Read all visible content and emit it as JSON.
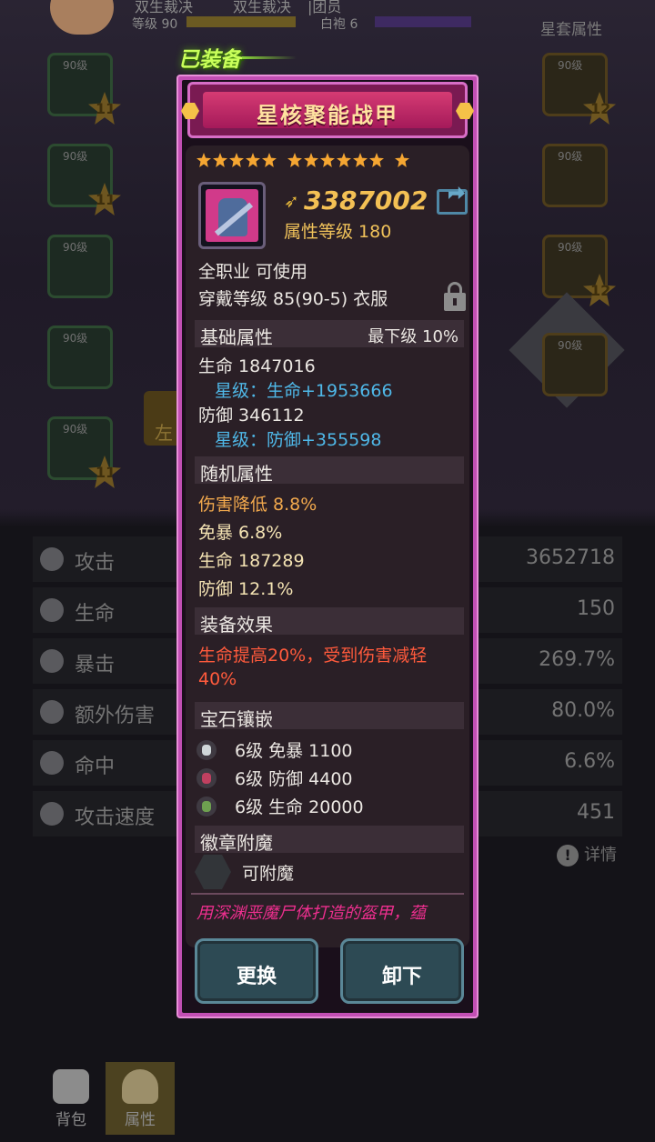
{
  "header": {
    "name_left": "双生裁决",
    "name_right": "双生裁决",
    "guild": "|团员",
    "level_label": "等级 90",
    "rank_label": "白袍 6",
    "set_attr_label": "星套属性"
  },
  "slots": {
    "level_text": "90级",
    "badges": [
      "11",
      "11",
      "11",
      "12",
      "12"
    ]
  },
  "side_button_label": "左",
  "stats": [
    {
      "name": "攻击",
      "value": "3652718"
    },
    {
      "name": "生命",
      "value": "150"
    },
    {
      "name": "暴击",
      "value": "269.7%"
    },
    {
      "name": "额外伤害",
      "value": "80.0%"
    },
    {
      "name": "命中",
      "value": "6.6%"
    },
    {
      "name": "攻击速度",
      "value": "451"
    }
  ],
  "detail_label": "详情",
  "tabs": {
    "bag": "背包",
    "attr": "属性"
  },
  "popup": {
    "equipped_tag": "已装备",
    "title": "星核聚能战甲",
    "stars": 12,
    "power_icon": "power-arrow-icon",
    "power": "3387002",
    "attr_level": "属性等级 180",
    "usable": "全职业 可使用",
    "wear_level": "穿戴等级 85(90-5) 衣服",
    "base_title": "基础属性",
    "base_grade": "最下级  10%",
    "base_hp": "生命  1847016",
    "base_hp_star": "星级：生命+1953666",
    "base_def": "防御  346112",
    "base_def_star": "星级：防御+355598",
    "random_title": "随机属性",
    "random": [
      {
        "text": "伤害降低   8.8%",
        "color": "#f1a84d"
      },
      {
        "text": "免暴   6.8%",
        "color": "#f4e3b3"
      },
      {
        "text": "生命   187289",
        "color": "#f4e3b3"
      },
      {
        "text": "防御   12.1%",
        "color": "#f4e3b3"
      }
    ],
    "effect_title": "装备效果",
    "effect_line1": "生命提高20%，受到伤害减轻",
    "effect_line2": "40%",
    "gem_title": "宝石镶嵌",
    "gems": [
      "6级   免暴 1100",
      "6级   防御 4400",
      "6级   生命 20000"
    ],
    "badge_title": "徽章附魔",
    "badge_status": "可附魔",
    "flavor": "用深渊恶魔尸体打造的盔甲，蕴",
    "btn_replace": "更换",
    "btn_unequip": "卸下"
  },
  "colors": {
    "frame": "#c24fb4",
    "title_banner": "#d53b73",
    "power": "#f3c054",
    "star_stat": "#4fb8e8",
    "effect": "#ff5a3c",
    "flavor": "#ee2f8f",
    "button": "#2d4a54"
  }
}
